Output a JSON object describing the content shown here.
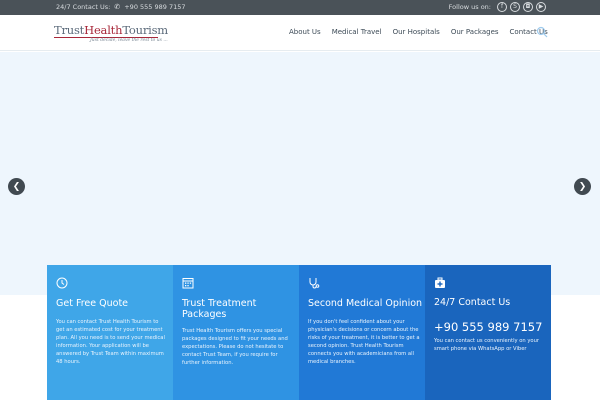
{
  "topbar": {
    "contact_label": "24/7 Contact Us:",
    "phone": "+90 555 989 7157",
    "follow_label": "Follow us on:"
  },
  "logo": {
    "part1": "Trust",
    "part2": "Health",
    "part3": "Tourism",
    "tagline": "Just decide, leave the rest to us ..."
  },
  "nav": [
    "About Us",
    "Medical Travel",
    "Our Hospitals",
    "Our Packages",
    "Contact Us"
  ],
  "features": [
    {
      "title": "Get Free Quote",
      "text": "You can contact Trust Health Tourism to get an estimated cost for your treatment plan. All you need is to send your medical information. Your application will be answered by Trust Team within maximum 48 hours."
    },
    {
      "title": "Trust Treatment Packages",
      "text": "Trust Health Tourism offers you special packages designed to fit your needs and expectations. Please do not hesitate to contact Trust Team, if you require for further information."
    },
    {
      "title": "Second Medical Opinion",
      "text": "If you don't feel confident about your physician's decisions or concern about the risks of your treatment, it is better to get a second opinion. Trust Health Tourism connects you with academicians from all medical branches."
    },
    {
      "title": "24/7 Contact Us",
      "phone": "+90 555 989 7157",
      "text": "You can contact us conveniently on your smart phone via WhatsApp or Viber"
    }
  ],
  "colors": {
    "card1": "#3fa6e8",
    "card2": "#2f93e3",
    "card3": "#2179d6",
    "card4": "#1a65bd",
    "brand_accent": "#a8283a"
  }
}
